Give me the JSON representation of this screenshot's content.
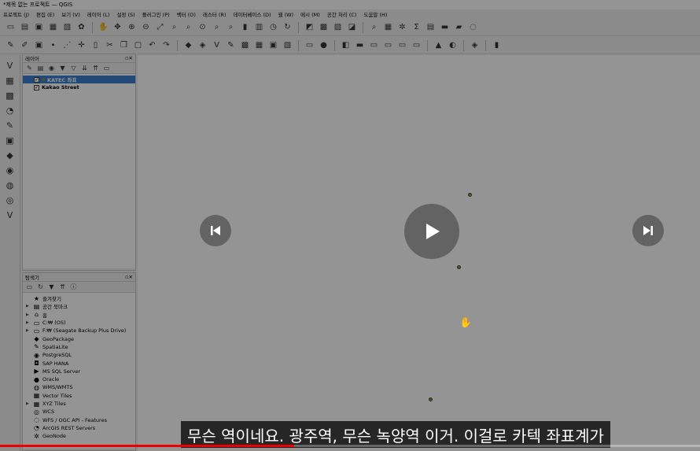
{
  "window": {
    "title": "*제목 없는 프로젝트 — QGIS"
  },
  "menu": [
    "프로젝트 (J)",
    "편집 (E)",
    "보기 (V)",
    "레이어 (L)",
    "설정 (S)",
    "플러그인 (P)",
    "벡터 (O)",
    "래스터 (R)",
    "데이터베이스 (D)",
    "웹 (W)",
    "메시 (M)",
    "공간 처리 (C)",
    "도움말 (H)"
  ],
  "layers_panel": {
    "title": "레이어",
    "layers": [
      {
        "name": "KATEC 좌표",
        "checked": true,
        "selected": true
      },
      {
        "name": "Kakao Street",
        "checked": true,
        "selected": false
      }
    ]
  },
  "browser_panel": {
    "title": "탐색기",
    "items": [
      {
        "label": "즐겨찾기",
        "icon": "star-icon",
        "expandable": false
      },
      {
        "label": "공간 북마크",
        "icon": "bookmark-icon",
        "expandable": true
      },
      {
        "label": "홈",
        "icon": "home-icon",
        "expandable": true
      },
      {
        "label": "C:₩ (OS)",
        "icon": "drive-icon",
        "expandable": true
      },
      {
        "label": "F:₩ (Seagate Backup Plus Drive)",
        "icon": "drive-icon",
        "expandable": true
      },
      {
        "label": "GeoPackage",
        "icon": "geopackage-icon",
        "expandable": false
      },
      {
        "label": "SpatiaLite",
        "icon": "spatialite-icon",
        "expandable": false
      },
      {
        "label": "PostgreSQL",
        "icon": "postgresql-icon",
        "expandable": false
      },
      {
        "label": "SAP HANA",
        "icon": "sap-hana-icon",
        "expandable": false
      },
      {
        "label": "MS SQL Server",
        "icon": "mssql-icon",
        "expandable": false
      },
      {
        "label": "Oracle",
        "icon": "oracle-icon",
        "expandable": false
      },
      {
        "label": "WMS/WMTS",
        "icon": "wms-icon",
        "expandable": false
      },
      {
        "label": "Vector Tiles",
        "icon": "vector-tiles-icon",
        "expandable": false
      },
      {
        "label": "XYZ Tiles",
        "icon": "xyz-tiles-icon",
        "expandable": true
      },
      {
        "label": "WCS",
        "icon": "wcs-icon",
        "expandable": false
      },
      {
        "label": "WFS / OGC API - Features",
        "icon": "wfs-icon",
        "expandable": false
      },
      {
        "label": "ArcGIS REST Servers",
        "icon": "arcgis-icon",
        "expandable": false
      },
      {
        "label": "GeoNode",
        "icon": "geonode-icon",
        "expandable": false
      }
    ]
  },
  "video": {
    "subtitle": "무슨 역이네요. 광주역, 무슨 녹양역 이거. 이걸로 카텍 좌표계가",
    "progress_fraction": 0.42
  },
  "colors": {
    "point": "#7b9a3a",
    "selection": "#3a7fd0",
    "progress": "#e00000"
  }
}
